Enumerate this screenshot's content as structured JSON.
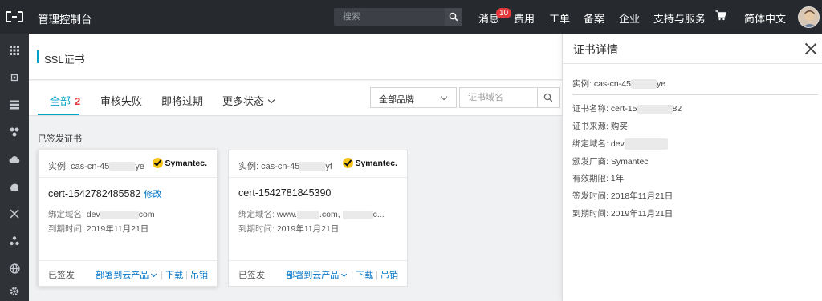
{
  "topbar": {
    "title": "管理控制台",
    "search_placeholder": "搜索",
    "nav": [
      "消息",
      "费用",
      "工单",
      "备案",
      "企业",
      "支持与服务",
      "简体中文"
    ],
    "message_badge": "10"
  },
  "sidebar": {
    "icons": [
      "apps-grid-icon",
      "chip-icon",
      "server-list-icon",
      "network-icon",
      "cloud-icon",
      "cdn-icon",
      "crossroads-icon",
      "cluster-icon",
      "globe-icon",
      "settings-icon"
    ]
  },
  "page": {
    "title": "SSL证书"
  },
  "tabs": [
    {
      "label": "全部",
      "count": "2"
    },
    {
      "label": "审核失败"
    },
    {
      "label": "即将过期"
    },
    {
      "label": "更多状态"
    }
  ],
  "filters": {
    "brand_selected": "全部品牌",
    "domain_placeholder": "证书域名"
  },
  "section_label": "已签发证书",
  "cards": [
    {
      "instance_prefix": "实例: cas-cn-45",
      "instance_suffix": "ye",
      "brand": "Symantec.",
      "name": "cert-1542782485582",
      "edit_label": "修改",
      "domain_label": "绑定域名:",
      "domain_value_a": "dev",
      "domain_value_b": "com",
      "expiry_label": "到期时间:",
      "expiry_value": "2019年11月21日",
      "status": "已签发",
      "actions": [
        "部署到云产品",
        "下载",
        "吊销"
      ]
    },
    {
      "instance_prefix": "实例: cas-cn-45",
      "instance_suffix": "yf",
      "brand": "Symantec.",
      "name": "cert-1542781845390",
      "edit_label": "",
      "domain_label": "绑定域名:",
      "domain_value_a": "www.",
      "domain_value_b": ".com,",
      "domain_value_c": "c...",
      "expiry_label": "到期时间:",
      "expiry_value": "2019年11月21日",
      "status": "已签发",
      "actions": [
        "部署到云产品",
        "下载",
        "吊销"
      ]
    }
  ],
  "detail": {
    "title": "证书详情",
    "instance_prefix": "实例: cas-cn-45",
    "instance_suffix": "ye",
    "rows": [
      {
        "key": "证书名称:",
        "value": "cert-15",
        "value_suffix": "82"
      },
      {
        "key": "证书来源:",
        "value": "购买"
      },
      {
        "key": "绑定域名:",
        "value": "dev"
      },
      {
        "key": "颁发厂商:",
        "value": "Symantec"
      },
      {
        "key": "有效期限:",
        "value": "1年"
      },
      {
        "key": "签发时间:",
        "value": "2018年11月21日"
      },
      {
        "key": "到期时间:",
        "value": "2019年11月21日"
      }
    ]
  },
  "colors": {
    "topbar": "#26292e",
    "sidebar": "#2f3338",
    "accent": "#00a2ca",
    "link": "#0073c7",
    "badge": "#e4393c"
  }
}
